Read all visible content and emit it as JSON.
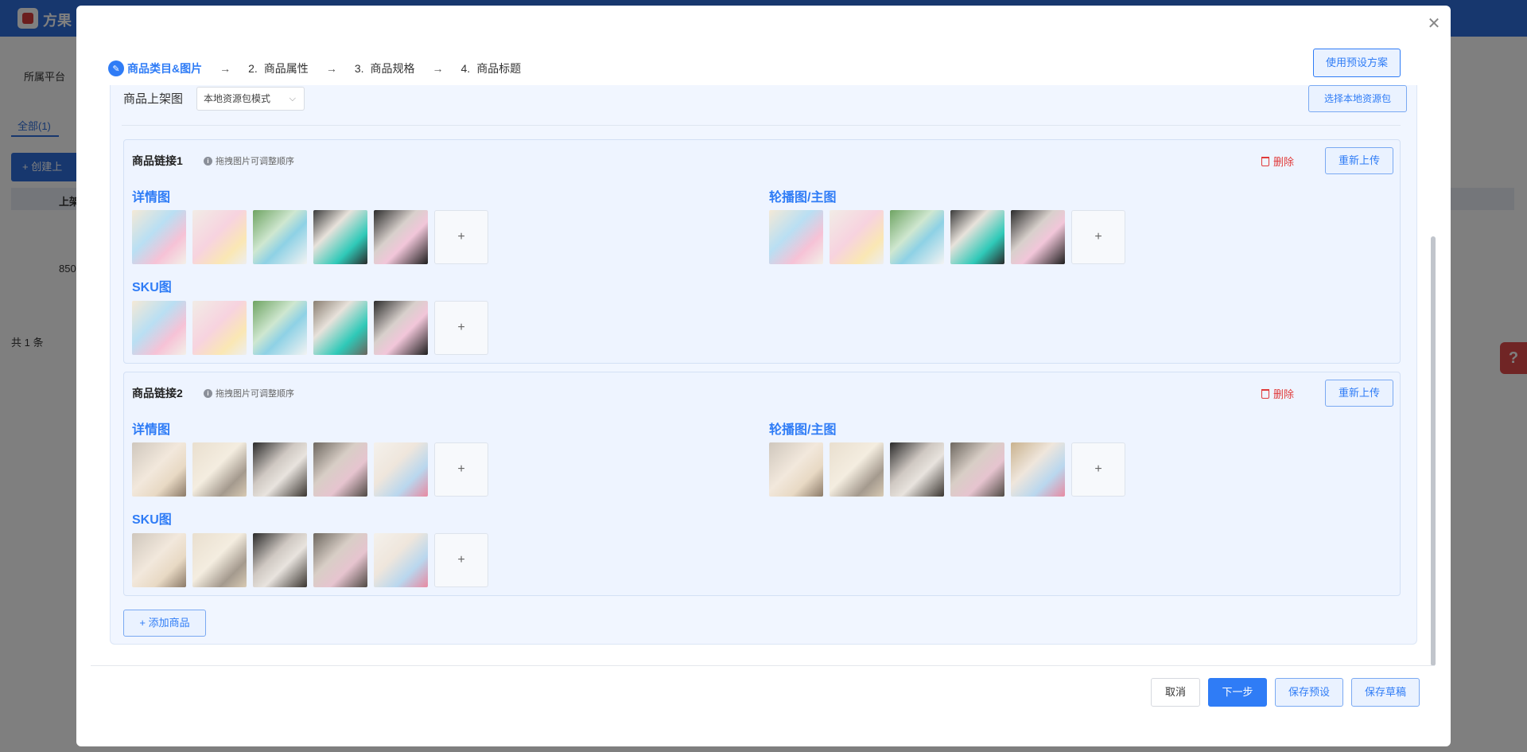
{
  "background": {
    "app_name": "方果",
    "platform_label": "所属平台",
    "tab_all": "全部(1)",
    "create_label": "+  创建上",
    "col_header": "上架",
    "row_id": "850",
    "total": "共 1 条"
  },
  "modal": {
    "steps": [
      {
        "num": "",
        "label": "商品类目&图片"
      },
      {
        "num": "2.",
        "label": "商品属性"
      },
      {
        "num": "3.",
        "label": "商品规格"
      },
      {
        "num": "4.",
        "label": "商品标题"
      }
    ],
    "preset_button": "使用预设方案",
    "shelf_label": "商品上架图",
    "shelf_mode": "本地资源包模式",
    "local_button": "选择本地资源包",
    "links": [
      {
        "title": "商品链接1",
        "hint": "拖拽图片可调整顺序",
        "delete": "删除",
        "reupload": "重新上传",
        "detail_title": "详情图",
        "carousel_title": "轮播图/主图",
        "sku_title": "SKU图"
      },
      {
        "title": "商品链接2",
        "hint": "拖拽图片可调整顺序",
        "delete": "删除",
        "reupload": "重新上传",
        "detail_title": "详情图",
        "carousel_title": "轮播图/主图",
        "sku_title": "SKU图"
      }
    ],
    "add_tile": "+",
    "add_product": "+ 添加商品",
    "footer": {
      "cancel": "取消",
      "next": "下一步",
      "save_preset": "保存预设",
      "save_draft": "保存草稿"
    }
  },
  "colors": {
    "primary": "#2f7cf6",
    "danger": "#e03a3a",
    "panel_bg": "#f1f6ff"
  }
}
